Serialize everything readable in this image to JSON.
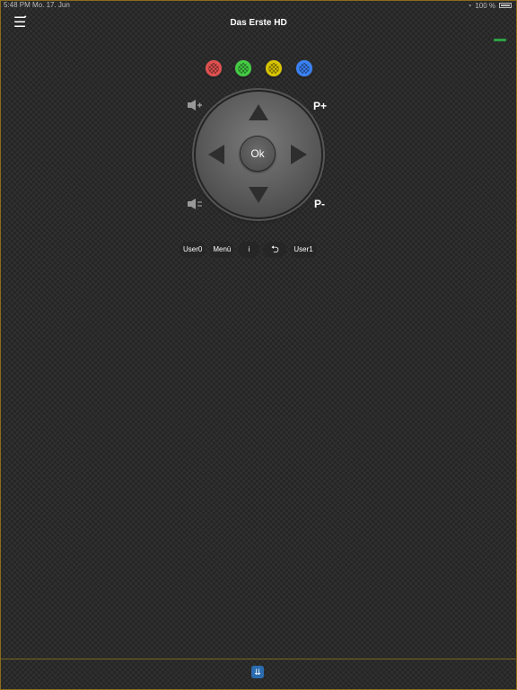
{
  "status_bar": {
    "time": "5:48 PM",
    "date": "Mo. 17. Jun",
    "battery": "100 %"
  },
  "header": {
    "menu_icon": "hamburger-icon",
    "menu_dot": "•",
    "title": "Das Erste HD"
  },
  "color_buttons": [
    {
      "name": "red",
      "color": "#e05050"
    },
    {
      "name": "green",
      "color": "#44cc44"
    },
    {
      "name": "yellow",
      "color": "#d8c400"
    },
    {
      "name": "blue",
      "color": "#3b82f6"
    }
  ],
  "dpad": {
    "ok_label": "Ok"
  },
  "channel": {
    "up_label": "P+",
    "down_label": "P-"
  },
  "volume": {
    "up_icon": "speaker-up-icon",
    "down_icon": "speaker-down-icon"
  },
  "bottom_row": {
    "user0": "User0",
    "menu": "Menü",
    "info": "i",
    "back_icon": "return-icon",
    "user1": "User1"
  },
  "footer": {
    "scroll_icon": "double-chevron-down-icon"
  }
}
